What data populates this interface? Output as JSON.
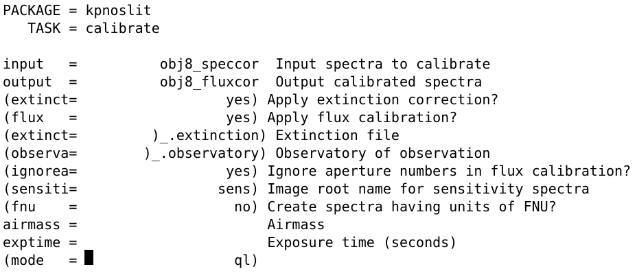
{
  "header": {
    "package_line": "PACKAGE = kpnoslit",
    "task_line": "   TASK = calibrate"
  },
  "params": [
    "input   =          obj8_speccor  Input spectra to calibrate",
    "output  =          obj8_fluxcor  Output calibrated spectra",
    "(extinct=                  yes) Apply extinction correction?",
    "(flux   =                  yes) Apply flux calibration?",
    "(extinct=         )_.extinction) Extinction file",
    "(observa=        )_.observatory) Observatory of observation",
    "(ignorea=                  yes) Ignore aperture numbers in flux calibration?",
    "(sensiti=                 sens) Image root name for sensitivity spectra",
    "(fnu    =                   no) Create spectra having units of FNU?",
    "airmass =                       Airmass",
    "exptime =                       Exposure time (seconds)",
    "(mode   =                   ql)"
  ]
}
